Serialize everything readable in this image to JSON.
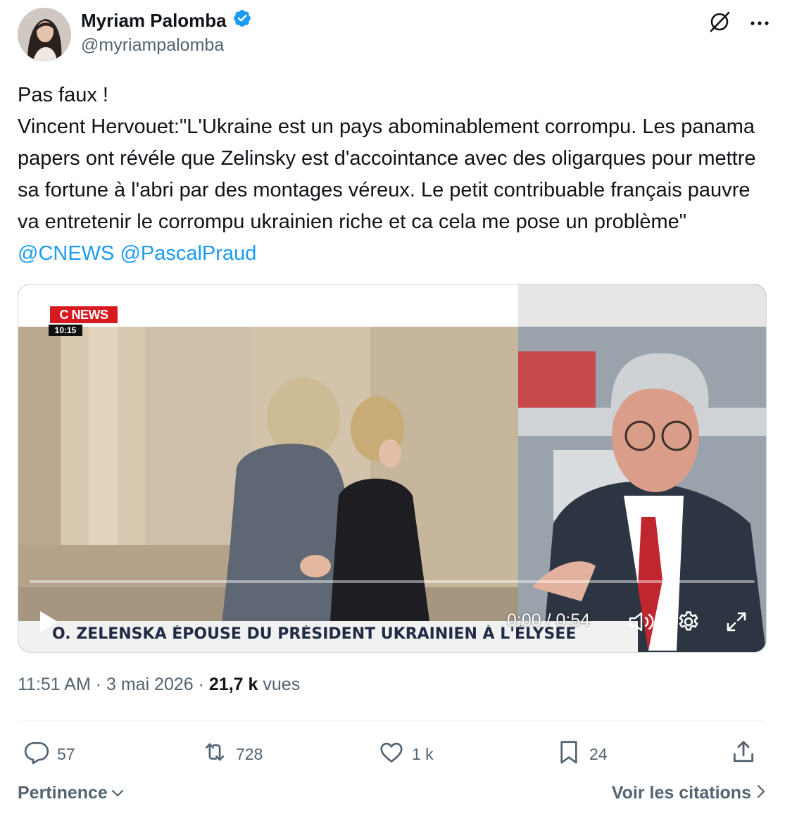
{
  "author": {
    "name": "Myriam Palomba",
    "handle": "@myriampalomba",
    "verified_icon": "verified-badge-icon",
    "badge_color": "#1d9bf0"
  },
  "header_icons": [
    "grok-icon",
    "more-icon"
  ],
  "tweet": {
    "line1": "Pas faux !",
    "body": "Vincent Hervouet:\"L'Ukraine est un pays abominablement corrompu.  Les panama papers ont révéle que Zelinsky est d'accointance avec des oligarques pour mettre sa fortune à l'abri par des montages véreux. Le petit contribuable français pauvre va entretenir le corrompu ukrainien riche et ca cela me pose un problème\" ",
    "mention1": "@CNEWS",
    "mention2": "@PascalPraud"
  },
  "video": {
    "channel_logo": "C NEWS",
    "clock": "10:15",
    "banner": "O. ZELENSKA ÉPOUSE DU PRÉSIDENT UKRAINIEN À L'ÉLYSÉE",
    "time": "0:00 / 0:54",
    "progress": 0
  },
  "meta": {
    "time": "11:51 AM",
    "sep1": " · ",
    "date": "3 mai 2026",
    "sep2": " · ",
    "views_count": "21,7 k",
    "views_label": " vues"
  },
  "actions": {
    "replies": "57",
    "reposts": "728",
    "likes": "1 k",
    "bookmarks": "24"
  },
  "footer": {
    "sort_label": "Pertinence",
    "quotes_label": "Voir les citations"
  },
  "colors": {
    "accent": "#1d9bf0",
    "muted": "#536471",
    "text": "#0f1419",
    "cnews_red": "#d71920"
  }
}
